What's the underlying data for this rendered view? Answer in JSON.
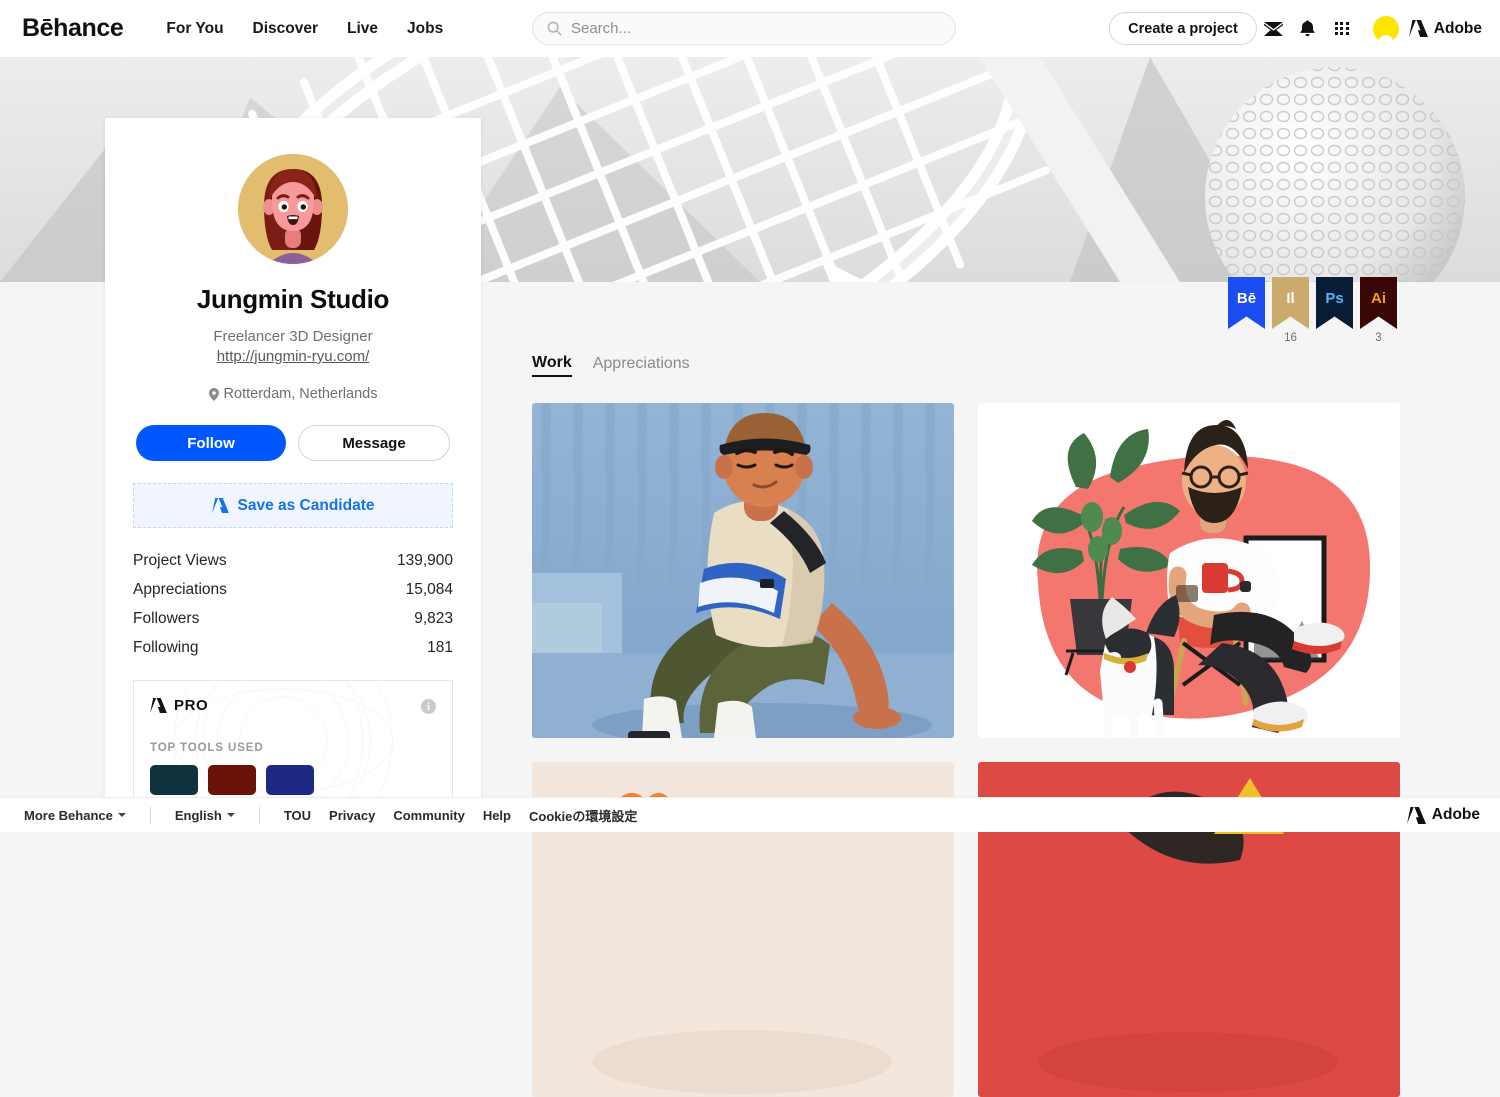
{
  "header": {
    "logo": "Bēhance",
    "nav": [
      {
        "label": "For You",
        "name": "nav-for-you"
      },
      {
        "label": "Discover",
        "name": "nav-discover"
      },
      {
        "label": "Live",
        "name": "nav-live"
      },
      {
        "label": "Jobs",
        "name": "nav-jobs"
      }
    ],
    "search": {
      "placeholder": "Search...",
      "value": ""
    },
    "create_label": "Create a project",
    "adobe_label": "Adobe",
    "icons": [
      "envelope-icon",
      "bell-icon",
      "apps-grid-icon",
      "user-avatar"
    ]
  },
  "profile": {
    "name": "Jungmin Studio",
    "role": "Freelancer 3D Designer",
    "url": "http://jungmin-ryu.com/",
    "location": "Rotterdam, Netherlands",
    "follow_label": "Follow",
    "message_label": "Message",
    "save_candidate_label": "Save as Candidate",
    "stats": [
      {
        "label": "Project Views",
        "value": "139,900"
      },
      {
        "label": "Appreciations",
        "value": "15,084"
      },
      {
        "label": "Followers",
        "value": "9,823"
      },
      {
        "label": "Following",
        "value": "181"
      }
    ],
    "pro": {
      "title": "PRO",
      "tools_label": "TOP TOOLS USED",
      "info": "i",
      "chips": [
        "#10323f",
        "#6b1206",
        "#1c2a86"
      ]
    }
  },
  "badges": [
    {
      "label": "Bē",
      "count": "",
      "bg": "#1b4df0",
      "fg": "#ffffff",
      "name": "badge-behance"
    },
    {
      "label": "Il",
      "count": "16",
      "bg": "#cbab6d",
      "fg": "#ffffff",
      "name": "badge-illustrator-tool"
    },
    {
      "label": "Ps",
      "count": "",
      "bg": "#071d36",
      "fg": "#5bb3f5",
      "name": "badge-photoshop"
    },
    {
      "label": "Ai",
      "count": "3",
      "bg": "#3a0707",
      "fg": "#f0a010",
      "name": "badge-illustrator"
    }
  ],
  "tabs": [
    {
      "label": "Work",
      "active": true
    },
    {
      "label": "Appreciations",
      "active": false
    }
  ],
  "gallery": [
    {
      "name": "project-thumb-seated-boy",
      "bg": "#7ea3c9"
    },
    {
      "name": "project-thumb-man-with-dog",
      "bg": "#ffffff"
    },
    {
      "name": "project-thumb-cream",
      "bg": "#f3e6dc"
    },
    {
      "name": "project-thumb-red",
      "bg": "#dd4a46"
    }
  ],
  "footer": {
    "more_behance": "More Behance",
    "language": "English",
    "links": [
      "TOU",
      "Privacy",
      "Community",
      "Help",
      "Cookieの環境設定"
    ],
    "adobe_label": "Adobe"
  },
  "colors": {
    "accent_blue": "#0057ff",
    "link_blue": "#1473e6",
    "page_bg": "#f5f5f5",
    "avatar_yellow": "#ffe400"
  }
}
